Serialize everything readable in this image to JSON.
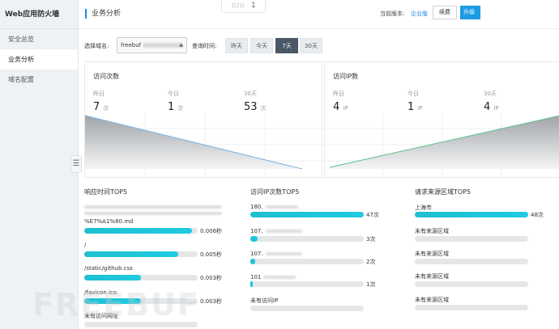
{
  "sidebar": {
    "title": "Web应用防火墙",
    "items": [
      {
        "label": "安全总览",
        "active": false
      },
      {
        "label": "业务分析",
        "active": true
      },
      {
        "label": "域名配置",
        "active": false
      }
    ],
    "collapse_icon": "list-collapse-icon"
  },
  "header": {
    "page_title": "业务分析",
    "notice_count": "1",
    "version_label": "当前版本:",
    "version_value": "企业版",
    "renew_label": "续费",
    "upgrade_label": "升级"
  },
  "filter": {
    "domain_label": "选择域名:",
    "domain_value": "freebuf",
    "time_label": "查询时间:",
    "ranges": [
      "昨天",
      "今天",
      "7天",
      "30天"
    ],
    "active_range": "7天"
  },
  "visits": {
    "title": "访问次数",
    "stats": [
      {
        "label": "昨日",
        "value": "7",
        "unit": "次"
      },
      {
        "label": "今日",
        "value": "1",
        "unit": "次"
      },
      {
        "label": "30天",
        "value": "53",
        "unit": "次"
      }
    ]
  },
  "ips": {
    "title": "访问IP数",
    "stats": [
      {
        "label": "昨日",
        "value": "4",
        "unit": "IP"
      },
      {
        "label": "今日",
        "value": "1",
        "unit": "IP"
      },
      {
        "label": "30天",
        "value": "4",
        "unit": "IP"
      }
    ]
  },
  "response_top5": {
    "title": "响应时间TOP5",
    "items": [
      {
        "label": "%E7%A1%80.md",
        "value": "0.006秒",
        "fraction": 0.95
      },
      {
        "label": "/",
        "value": "0.005秒",
        "fraction": 0.83
      },
      {
        "label": "/static/github.css",
        "value": "0.003秒",
        "fraction": 0.5
      },
      {
        "label": "/favicon.ico",
        "value": "0.003秒",
        "fraction": 0.5
      },
      {
        "label": "未有访问网址",
        "value": "",
        "fraction": 0
      }
    ]
  },
  "ip_top5": {
    "title": "访问IP次数TOP5",
    "items": [
      {
        "label": "180.",
        "value": "47次",
        "fraction": 1.0
      },
      {
        "label": "107.",
        "value": "3次",
        "fraction": 0.064
      },
      {
        "label": "107.",
        "value": "2次",
        "fraction": 0.043
      },
      {
        "label": "101",
        "value": "1次",
        "fraction": 0.021
      },
      {
        "label": "未有访问IP",
        "value": "",
        "fraction": 0
      }
    ]
  },
  "region_top5": {
    "title": "请求来源区域TOP5",
    "items": [
      {
        "label": "上海市",
        "value": "48次",
        "fraction": 1.0
      },
      {
        "label": "未有来源区域",
        "value": "",
        "fraction": 0
      },
      {
        "label": "未有来源区域",
        "value": "",
        "fraction": 0
      },
      {
        "label": "未有来源区域",
        "value": "",
        "fraction": 0
      },
      {
        "label": "未有来源区域",
        "value": "",
        "fraction": 0
      }
    ]
  },
  "watermark": "FREEBUF",
  "colors": {
    "accent": "#1e9be5",
    "bar": "#1fbfd1",
    "active_range": "#4a5766"
  }
}
